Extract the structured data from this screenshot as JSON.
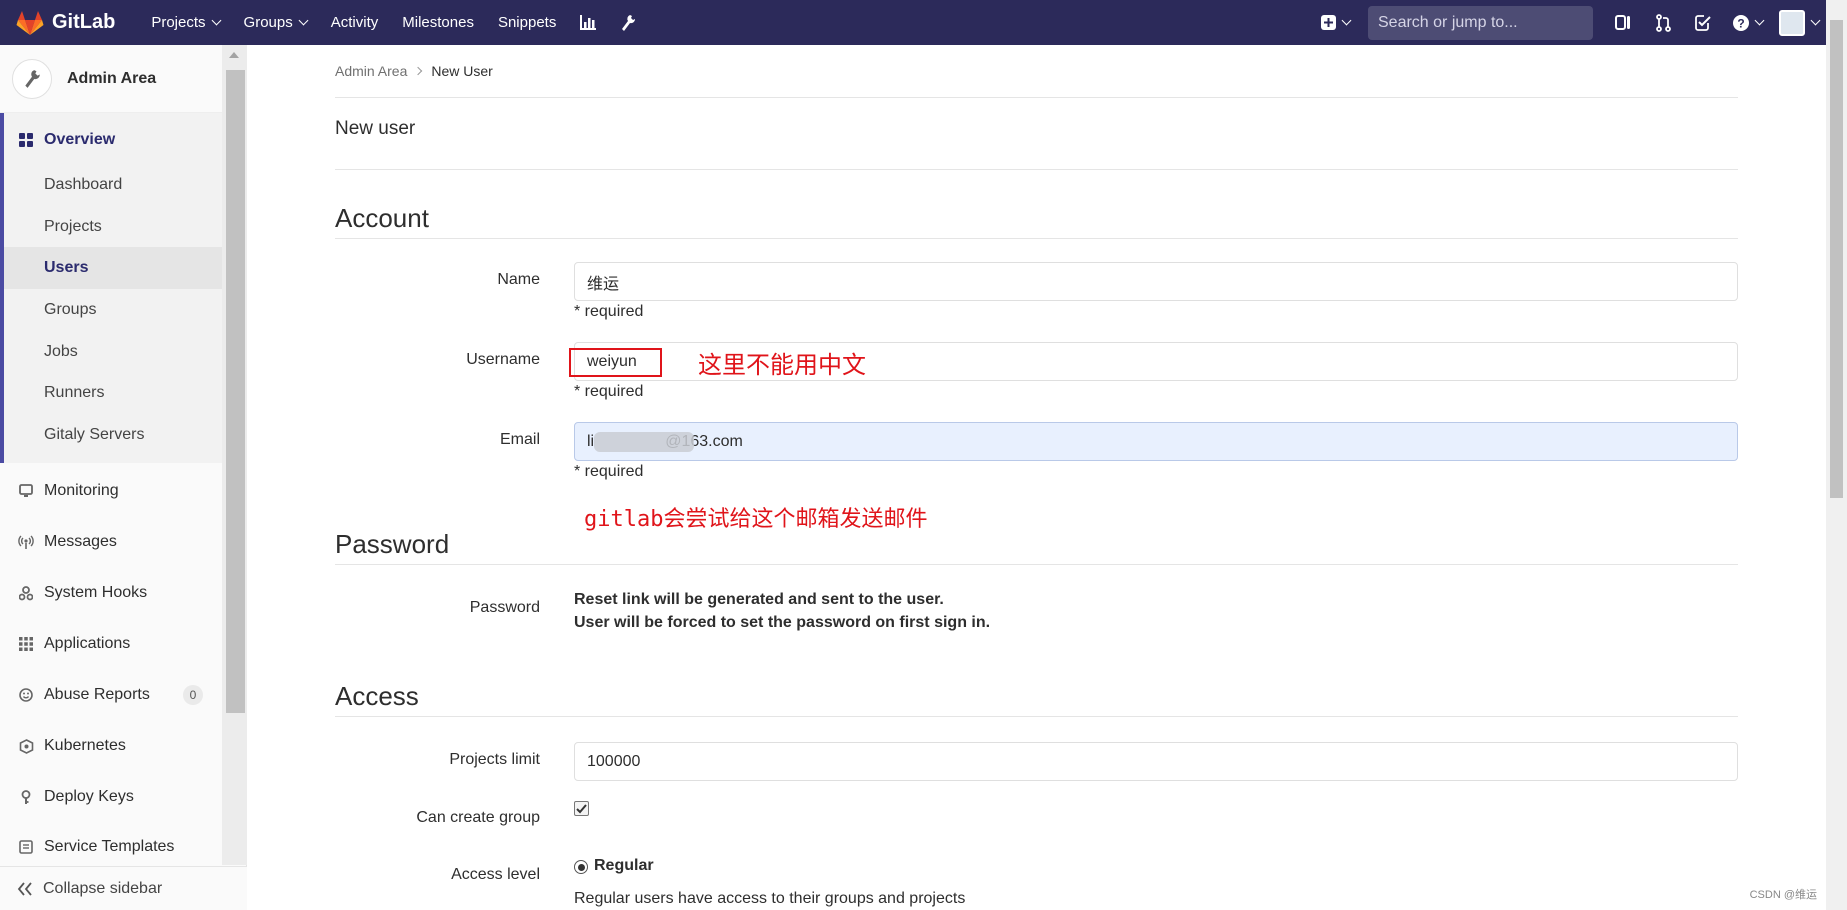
{
  "topbar": {
    "brand": "GitLab",
    "nav": [
      {
        "label": "Projects",
        "dropdown": true
      },
      {
        "label": "Groups",
        "dropdown": true
      },
      {
        "label": "Activity",
        "dropdown": false
      },
      {
        "label": "Milestones",
        "dropdown": false
      },
      {
        "label": "Snippets",
        "dropdown": false
      }
    ],
    "search_placeholder": "Search or jump to...",
    "colors": {
      "background": "#2c2a5a"
    }
  },
  "sidebar": {
    "title": "Admin Area",
    "overview": "Overview",
    "sub_items": [
      {
        "label": "Dashboard"
      },
      {
        "label": "Projects"
      },
      {
        "label": "Users",
        "active": true
      },
      {
        "label": "Groups"
      },
      {
        "label": "Jobs"
      },
      {
        "label": "Runners"
      },
      {
        "label": "Gitaly Servers"
      }
    ],
    "items": [
      {
        "label": "Monitoring",
        "icon": "monitor-icon"
      },
      {
        "label": "Messages",
        "icon": "broadcast-icon"
      },
      {
        "label": "System Hooks",
        "icon": "hook-icon"
      },
      {
        "label": "Applications",
        "icon": "apps-icon"
      },
      {
        "label": "Abuse Reports",
        "icon": "smiley-icon",
        "badge": "0"
      },
      {
        "label": "Kubernetes",
        "icon": "kubernetes-icon"
      },
      {
        "label": "Deploy Keys",
        "icon": "key-icon"
      },
      {
        "label": "Service Templates",
        "icon": "template-icon"
      }
    ],
    "collapse": "Collapse sidebar"
  },
  "breadcrumb": {
    "parent": "Admin Area",
    "current": "New User"
  },
  "page_title": "New user",
  "account": {
    "title": "Account",
    "name_label": "Name",
    "name_value": "维运",
    "username_label": "Username",
    "username_value": "weiyun",
    "email_label": "Email",
    "email_value": "li                @163.com",
    "required": "* required"
  },
  "annotations": {
    "username_note": "这里不能用中文",
    "email_note": "gitlab会尝试给这个邮箱发送邮件"
  },
  "password": {
    "title": "Password",
    "label": "Password",
    "line1": "Reset link will be generated and sent to the user.",
    "line2": "User will be forced to set the password on first sign in."
  },
  "access": {
    "title": "Access",
    "projects_limit_label": "Projects limit",
    "projects_limit_value": "100000",
    "can_create_group_label": "Can create group",
    "can_create_group": true,
    "access_level_label": "Access level",
    "regular_label": "Regular",
    "regular_desc": "Regular users have access to their groups and projects"
  },
  "watermark": "CSDN @维运"
}
